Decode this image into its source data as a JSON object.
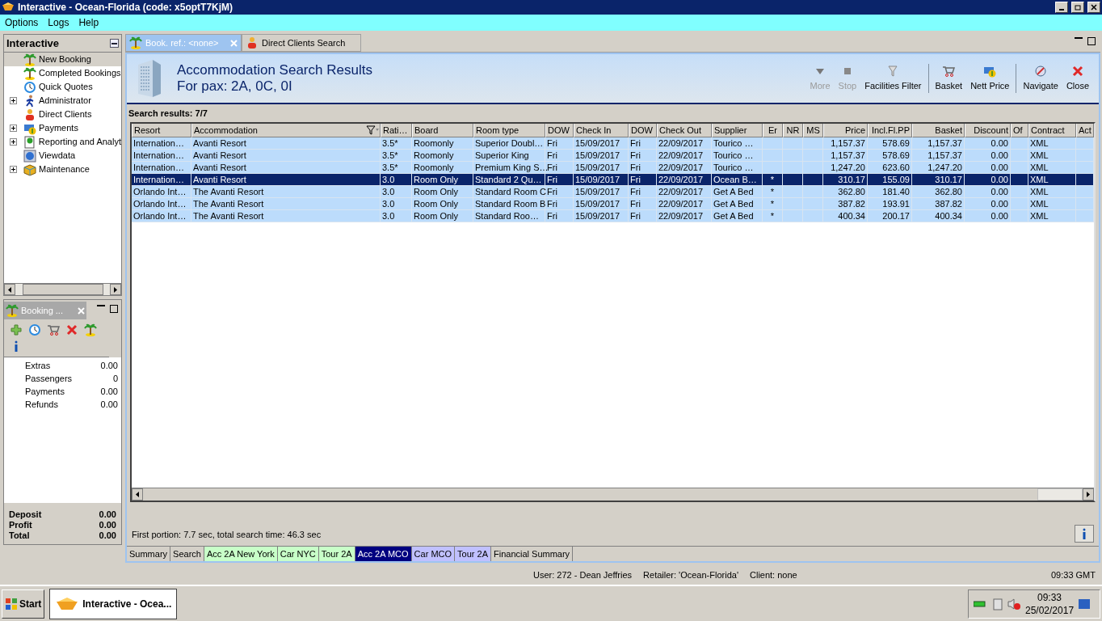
{
  "window": {
    "title": "Interactive - Ocean-Florida (code: x5optT7KjM)"
  },
  "menu": [
    "Options",
    "Logs",
    "Help"
  ],
  "sidebar": {
    "title": "Interactive",
    "items": [
      {
        "label": "New Booking",
        "kind": "leaf",
        "selected": true
      },
      {
        "label": "Completed Bookings",
        "kind": "leaf",
        "selected": false
      },
      {
        "label": "Quick Quotes",
        "kind": "leaf",
        "selected": false
      },
      {
        "label": "Administrator",
        "kind": "group",
        "expanded": false,
        "selected": false
      },
      {
        "label": "Direct Clients",
        "kind": "leaf",
        "selected": false
      },
      {
        "label": "Payments",
        "kind": "group",
        "expanded": false,
        "selected": false
      },
      {
        "label": "Reporting and Analyt",
        "kind": "group",
        "expanded": false,
        "selected": false
      },
      {
        "label": "Viewdata",
        "kind": "leaf",
        "selected": false
      },
      {
        "label": "Maintenance",
        "kind": "group",
        "expanded": false,
        "selected": false
      }
    ]
  },
  "booking_panel": {
    "title": "Booking ...",
    "lines": [
      {
        "label": "Extras",
        "value": "0.00"
      },
      {
        "label": "Passengers",
        "value": "0"
      },
      {
        "label": "Payments",
        "value": "0.00"
      },
      {
        "label": "Refunds",
        "value": "0.00"
      }
    ],
    "totals": [
      {
        "label": "Deposit",
        "value": "0.00"
      },
      {
        "label": "Profit",
        "value": "0.00"
      },
      {
        "label": "Total",
        "value": "0.00"
      }
    ]
  },
  "tabs": [
    {
      "label": "Book. ref.: <none>",
      "selected": true
    },
    {
      "label": "Direct Clients Search",
      "selected": false
    }
  ],
  "header": {
    "title": "Accommodation Search Results",
    "subtitle": "For pax: 2A, 0C, 0I"
  },
  "toolbar": [
    {
      "kind": "button",
      "label": "More",
      "disabled": true
    },
    {
      "kind": "button",
      "label": "Stop",
      "disabled": true
    },
    {
      "kind": "button",
      "label": "Facilities Filter",
      "disabled": false
    },
    {
      "kind": "separator"
    },
    {
      "kind": "button",
      "label": "Basket",
      "disabled": false
    },
    {
      "kind": "button",
      "label": "Nett Price",
      "disabled": false
    },
    {
      "kind": "separator"
    },
    {
      "kind": "button",
      "label": "Navigate",
      "disabled": false
    },
    {
      "kind": "button",
      "label": "Close",
      "disabled": false
    }
  ],
  "results_label": "Search results: 7/7",
  "table": {
    "columns": [
      {
        "label": "Resort",
        "kind": "text",
        "filtered": false
      },
      {
        "label": "Accommodation",
        "kind": "text",
        "filtered": true
      },
      {
        "label": "Rati…",
        "kind": "text",
        "filtered": false
      },
      {
        "label": "Board",
        "kind": "text",
        "filtered": false
      },
      {
        "label": "Room type",
        "kind": "text",
        "filtered": false
      },
      {
        "label": "DOW",
        "kind": "text",
        "filtered": false
      },
      {
        "label": "Check In",
        "kind": "text",
        "filtered": false
      },
      {
        "label": "DOW",
        "kind": "text",
        "filtered": false
      },
      {
        "label": "Check Out",
        "kind": "text",
        "filtered": false
      },
      {
        "label": "Supplier",
        "kind": "text",
        "filtered": false
      },
      {
        "label": "Er",
        "kind": "center",
        "filtered": false
      },
      {
        "label": "NR",
        "kind": "center",
        "filtered": false
      },
      {
        "label": "MS",
        "kind": "center",
        "filtered": false
      },
      {
        "label": "Price",
        "kind": "number",
        "filtered": false
      },
      {
        "label": "Incl.Fl.PP",
        "kind": "number",
        "filtered": false
      },
      {
        "label": "Basket",
        "kind": "number",
        "filtered": false
      },
      {
        "label": "Discount",
        "kind": "number",
        "filtered": false
      },
      {
        "label": "Of",
        "kind": "text",
        "filtered": false
      },
      {
        "label": "Contract",
        "kind": "text",
        "filtered": false
      },
      {
        "label": "Act",
        "kind": "text",
        "filtered": false
      }
    ],
    "rows": [
      {
        "selected": false,
        "cells": [
          "Internation…",
          "Avanti Resort",
          "3.5*",
          "Roomonly",
          "Superior Doubl…",
          "Fri",
          "15/09/2017",
          "Fri",
          "22/09/2017",
          "Tourico …",
          "",
          "",
          "",
          "1,157.37",
          "578.69",
          "1,157.37",
          "0.00",
          "",
          "XML",
          ""
        ]
      },
      {
        "selected": false,
        "cells": [
          "Internation…",
          "Avanti Resort",
          "3.5*",
          "Roomonly",
          "Superior King",
          "Fri",
          "15/09/2017",
          "Fri",
          "22/09/2017",
          "Tourico …",
          "",
          "",
          "",
          "1,157.37",
          "578.69",
          "1,157.37",
          "0.00",
          "",
          "XML",
          ""
        ]
      },
      {
        "selected": false,
        "cells": [
          "Internation…",
          "Avanti Resort",
          "3.5*",
          "Roomonly",
          "Premium King S…",
          "Fri",
          "15/09/2017",
          "Fri",
          "22/09/2017",
          "Tourico …",
          "",
          "",
          "",
          "1,247.20",
          "623.60",
          "1,247.20",
          "0.00",
          "",
          "XML",
          ""
        ]
      },
      {
        "selected": true,
        "cells": [
          "Internation…",
          "Avanti Resort",
          "3.0",
          "Room Only",
          "Standard 2 Qu…",
          "Fri",
          "15/09/2017",
          "Fri",
          "22/09/2017",
          "Ocean B…",
          "*",
          "",
          "",
          "310.17",
          "155.09",
          "310.17",
          "0.00",
          "",
          "XML",
          ""
        ]
      },
      {
        "selected": false,
        "cells": [
          "Orlando Int…",
          "The Avanti Resort",
          "3.0",
          "Room Only",
          "Standard Room C",
          "Fri",
          "15/09/2017",
          "Fri",
          "22/09/2017",
          "Get A Bed",
          "*",
          "",
          "",
          "362.80",
          "181.40",
          "362.80",
          "0.00",
          "",
          "XML",
          ""
        ]
      },
      {
        "selected": false,
        "cells": [
          "Orlando Int…",
          "The Avanti Resort",
          "3.0",
          "Room Only",
          "Standard Room B",
          "Fri",
          "15/09/2017",
          "Fri",
          "22/09/2017",
          "Get A Bed",
          "*",
          "",
          "",
          "387.82",
          "193.91",
          "387.82",
          "0.00",
          "",
          "XML",
          ""
        ]
      },
      {
        "selected": false,
        "cells": [
          "Orlando Int…",
          "The Avanti Resort",
          "3.0",
          "Room Only",
          "Standard Roo…",
          "Fri",
          "15/09/2017",
          "Fri",
          "22/09/2017",
          "Get A Bed",
          "*",
          "",
          "",
          "400.34",
          "200.17",
          "400.34",
          "0.00",
          "",
          "XML",
          ""
        ]
      }
    ]
  },
  "search_time": "First portion: 7.7 sec, total search time: 46.3 sec",
  "bottom_tabs": [
    {
      "label": "Summary",
      "color": "#d4d0c8",
      "selected": false
    },
    {
      "label": "Search",
      "color": "#d4d0c8",
      "selected": false
    },
    {
      "label": "Acc 2A New York",
      "color": "#c8ffc8",
      "selected": false
    },
    {
      "label": "Car NYC",
      "color": "#c8ffc8",
      "selected": false
    },
    {
      "label": "Tour 2A",
      "color": "#c8ffc8",
      "selected": false
    },
    {
      "label": "Acc 2A MCO",
      "color": "#000080",
      "selected": true
    },
    {
      "label": "Car MCO",
      "color": "#c0c0ff",
      "selected": false
    },
    {
      "label": "Tour 2A",
      "color": "#c0c0ff",
      "selected": false
    },
    {
      "label": "Financial Summary",
      "color": "#d4d0c8",
      "selected": false
    }
  ],
  "status_bar": {
    "user": "User: 272 - Dean Jeffries",
    "retailer": "Retailer: 'Ocean-Florida'",
    "client": "Client: none",
    "time": "09:33 GMT"
  },
  "taskbar": {
    "start": "Start",
    "task": "Interactive - Ocea...",
    "time": "09:33",
    "date": "25/02/2017"
  }
}
